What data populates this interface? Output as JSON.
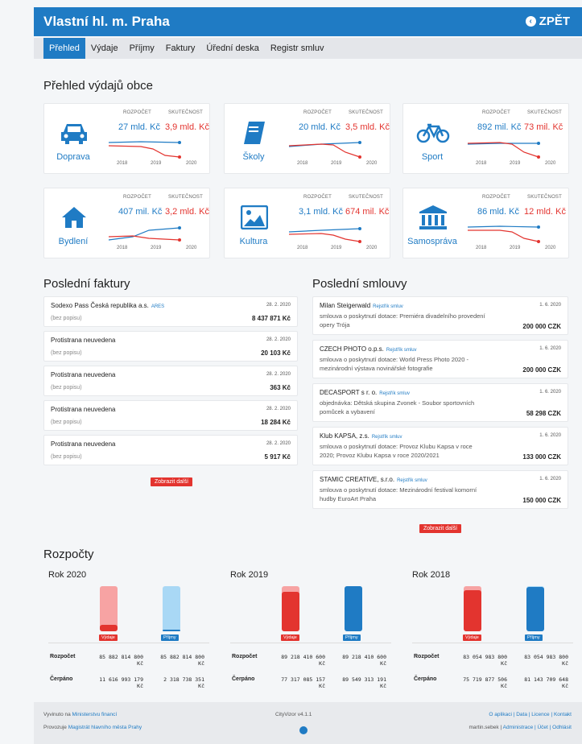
{
  "header": {
    "title": "Vlastní hl. m. Praha",
    "back_label": "ZPĚT"
  },
  "tabs": [
    "Přehled",
    "Výdaje",
    "Příjmy",
    "Faktury",
    "Úřední deska",
    "Registr smluv"
  ],
  "overview": {
    "title": "Přehled výdajů obce",
    "budget_label": "ROZPOČET",
    "actual_label": "SKUTEČNOST",
    "years": [
      "2018",
      "2019",
      "2020"
    ],
    "cards": [
      {
        "name": "Doprava",
        "icon": "car-icon",
        "budget": "27 mld. Kč",
        "actual": "3,9 mld. Kč"
      },
      {
        "name": "Školy",
        "icon": "book-icon",
        "budget": "20 mld. Kč",
        "actual": "3,5 mld. Kč"
      },
      {
        "name": "Sport",
        "icon": "bicycle-icon",
        "budget": "892 mil. Kč",
        "actual": "73 mil. Kč"
      },
      {
        "name": "Bydlení",
        "icon": "house-icon",
        "budget": "407 mil. Kč",
        "actual": "3,2 mld. Kč"
      },
      {
        "name": "Kultura",
        "icon": "image-icon",
        "budget": "3,1 mld. Kč",
        "actual": "674 mil. Kč"
      },
      {
        "name": "Samospráva",
        "icon": "building-icon",
        "budget": "86 mld. Kč",
        "actual": "12 mld. Kč"
      }
    ]
  },
  "invoices": {
    "title": "Poslední faktury",
    "items": [
      {
        "party": "Sodexo Pass Česká republika a.s.",
        "link": "ARES",
        "date": "28. 2. 2020",
        "desc": "(bez popisu)",
        "amount": "8 437 871 Kč"
      },
      {
        "party": "Protistrana neuvedena",
        "link": "",
        "date": "28. 2. 2020",
        "desc": "(bez popisu)",
        "amount": "20 103 Kč"
      },
      {
        "party": "Protistrana neuvedena",
        "link": "",
        "date": "28. 2. 2020",
        "desc": "(bez popisu)",
        "amount": "363 Kč"
      },
      {
        "party": "Protistrana neuvedena",
        "link": "",
        "date": "28. 2. 2020",
        "desc": "(bez popisu)",
        "amount": "18 284 Kč"
      },
      {
        "party": "Protistrana neuvedena",
        "link": "",
        "date": "28. 2. 2020",
        "desc": "(bez popisu)",
        "amount": "5 917 Kč"
      }
    ],
    "more_label": "Zobrazit další"
  },
  "contracts": {
    "title": "Poslední smlouvy",
    "link_label": "Rejstřík smluv",
    "items": [
      {
        "party": "Milan Steigerwald",
        "date": "1. 6. 2020",
        "line1": "smlouva o poskytnutí dotace: Premiéra divadelního provedení",
        "line2": "opery Trója",
        "amount": "200 000 CZK"
      },
      {
        "party": "CZECH PHOTO o.p.s.",
        "date": "1. 6. 2020",
        "line1": "smlouva o poskytnutí dotace: World Press Photo 2020 -",
        "line2": "mezinárodní výstava novinářské fotografie",
        "amount": "200 000 CZK"
      },
      {
        "party": "DECASPORT s r. o.",
        "date": "1. 6. 2020",
        "line1": "objednávka: Dětská skupina Zvonek - Soubor sportovních",
        "line2": "pomůcek a vybavení",
        "amount": "58 298 CZK"
      },
      {
        "party": "Klub KAPSA, z.s.",
        "date": "1. 6. 2020",
        "line1": "smlouva o poskytnutí dotace: Provoz Klubu Kapsa v roce",
        "line2": "2020; Provoz Klubu Kapsa v roce 2020/2021",
        "amount": "133 000 CZK"
      },
      {
        "party": "STAMIC CREATIVE, s.r.o.",
        "date": "1. 6. 2020",
        "line1": "smlouva o poskytnutí dotace: Mezinárodní festival komorní",
        "line2": "hudby EuroArt Praha",
        "amount": "150 000 CZK"
      }
    ],
    "more_label": "Zobrazit další"
  },
  "budgets": {
    "title": "Rozpočty",
    "expense_label": "Výdaje",
    "income_label": "Příjmy",
    "row_budget": "Rozpočet",
    "row_spent": "Čerpáno",
    "years": [
      {
        "year": "Rok 2020",
        "budget_exp": "85 882 814 800",
        "budget_inc": "85 882 814 800",
        "spent_exp": "11 616 993 179",
        "spent_inc": "2 318 738 351",
        "cur": "Kč",
        "exp_fill": 0.135,
        "inc_fill": 0.027
      },
      {
        "year": "Rok 2019",
        "budget_exp": "89 218 410 600",
        "budget_inc": "89 218 410 600",
        "spent_exp": "77 317 085 157",
        "spent_inc": "89 549 313 191",
        "cur": "Kč",
        "exp_fill": 0.867,
        "inc_fill": 1.0
      },
      {
        "year": "Rok 2018",
        "budget_exp": "83 054 983 800",
        "budget_inc": "83 054 983 800",
        "spent_exp": "75 719 877 506",
        "spent_inc": "81 143 709 648",
        "cur": "Kč",
        "exp_fill": 0.912,
        "inc_fill": 0.977
      }
    ]
  },
  "footer": {
    "dev_prefix": "Vyvinuto na",
    "dev_link": "Ministerstvu financí",
    "op_prefix": "Provozuje",
    "op_link": "Magistrát hlavního města Prahy",
    "version": "CityVizor v4.1.1",
    "links_right": "O aplikaci | Data | Licence | Kontakt",
    "user": "martin.sebek",
    "user_links": "Administrace | Účet | Odhlásit"
  },
  "colors": {
    "brand": "#1f7bc4",
    "red": "#e3342f",
    "light_red": "#f7a3a3",
    "light_blue": "#a9d8f5"
  }
}
